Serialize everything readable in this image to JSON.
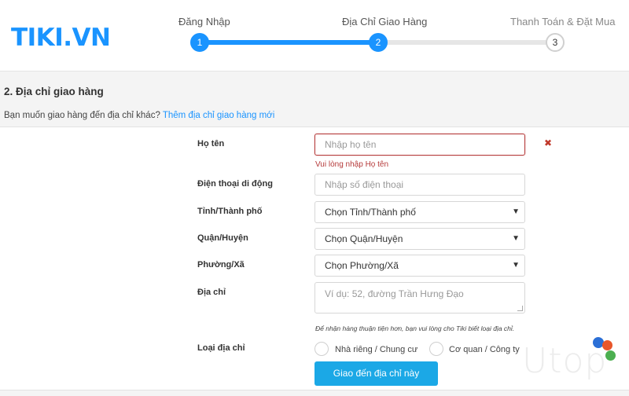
{
  "header": {
    "logo": "TIKI.VN",
    "steps": [
      {
        "label": "Đăng Nhập",
        "number": "1",
        "status": "completed"
      },
      {
        "label": "Địa Chỉ Giao Hàng",
        "number": "2",
        "status": "current"
      },
      {
        "label": "Thanh Toán & Đặt Mua",
        "number": "3",
        "status": "upcoming"
      }
    ]
  },
  "section": {
    "title": "2. Địa chỉ giao hàng",
    "question": "Bạn muốn giao hàng đến địa chỉ khác?",
    "add_new_link": "Thêm địa chỉ giao hàng mới"
  },
  "form": {
    "name_label": "Họ tên",
    "name_placeholder": "Nhập họ tên",
    "name_error": "Vui lòng nhập Họ tên",
    "phone_label": "Điện thoại di động",
    "phone_placeholder": "Nhập số điện thoại",
    "province_label": "Tỉnh/Thành phố",
    "province_value": "Chọn Tỉnh/Thành phố",
    "district_label": "Quận/Huyện",
    "district_value": "Chọn Quận/Huyện",
    "ward_label": "Phường/Xã",
    "ward_value": "Chọn Phường/Xã",
    "address_label": "Địa chỉ",
    "address_placeholder": "Ví dụ: 52, đường Trần Hưng Đạo",
    "address_hint": "Để nhận hàng thuận tiện hơn, bạn vui lòng cho Tiki biết loại địa chỉ.",
    "type_label": "Loại địa chỉ",
    "type_options": [
      "Nhà riêng / Chung cư",
      "Cơ quan / Công ty"
    ],
    "submit_label": "Giao đến địa chỉ này"
  },
  "icons": {
    "dropdown": "caret-down-icon",
    "clear": "close-icon"
  },
  "colors": {
    "brand": "#1a94ff",
    "button": "#1ba8e6",
    "error": "#b53a3a"
  },
  "watermark": "Utop"
}
